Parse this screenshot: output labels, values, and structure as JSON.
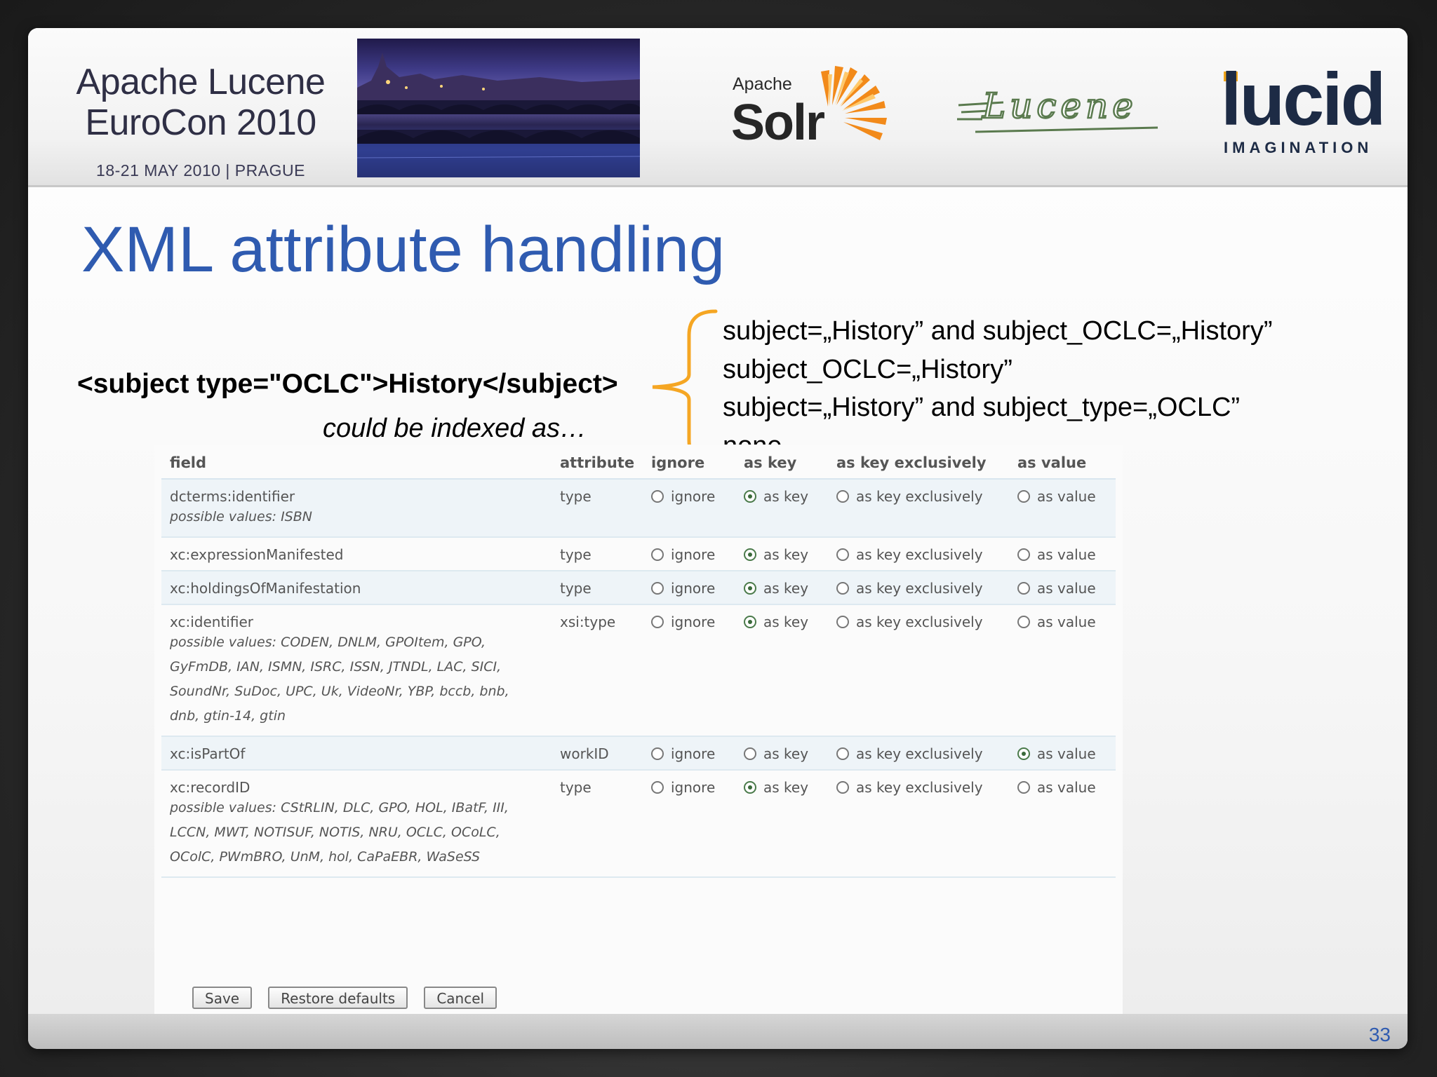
{
  "header": {
    "conference_line1": "Apache Lucene",
    "conference_line2": "EuroCon 2010",
    "conference_dates": "18-21 MAY 2010  |  PRAGUE",
    "solr_apache": "Apache",
    "solr_name": "Solr",
    "lucene_name": "Lucene",
    "lucid_name": "lucid",
    "lucid_sub": "IMAGINATION"
  },
  "title": "XML attribute handling",
  "example": {
    "xml": "<subject type=\"OCLC\">History</subject>",
    "caption": "could be indexed as…",
    "options": [
      "subject=„History” and subject_OCLC=„History”",
      "subject_OCLC=„History”",
      "subject=„History” and subject_type=„OCLC”",
      "none"
    ]
  },
  "table": {
    "headers": [
      "field",
      "attribute",
      "ignore",
      "as key",
      "as key exclusively",
      "as value"
    ],
    "option_labels": [
      "ignore",
      "as key",
      "as key exclusively",
      "as value"
    ],
    "rows": [
      {
        "field": "dcterms:identifier",
        "possible": "possible values: ISBN",
        "attribute": "type",
        "selected": "as key"
      },
      {
        "field": "xc:expressionManifested",
        "possible": "",
        "attribute": "type",
        "selected": "as key"
      },
      {
        "field": "xc:holdingsOfManifestation",
        "possible": "",
        "attribute": "type",
        "selected": "as key"
      },
      {
        "field": "xc:identifier",
        "possible": "possible values: CODEN, DNLM, GPOItem, GPO, GyFmDB, IAN, ISMN, ISRC, ISSN, JTNDL, LAC, SICI, SoundNr, SuDoc, UPC, Uk, VideoNr, YBP, bccb, bnb, dnb, gtin-14, gtin",
        "attribute": "xsi:type",
        "selected": "as key"
      },
      {
        "field": "xc:isPartOf",
        "possible": "",
        "attribute": "workID",
        "selected": "as value"
      },
      {
        "field": "xc:recordID",
        "possible": "possible values: CStRLIN, DLC, GPO, HOL, IBatF, III, LCCN, MWT, NOTISUF, NOTIS, NRU, OCLC, OCoLC, OColC, PWmBRO, UnM, hol, CaPaEBR, WaSeSS",
        "attribute": "type",
        "selected": "as key"
      }
    ]
  },
  "buttons": {
    "save": "Save",
    "restore": "Restore defaults",
    "cancel": "Cancel"
  },
  "page_number": "33",
  "colors": {
    "title_blue": "#2f5bb0",
    "brace_orange": "#f5a623",
    "row_alt": "#eef4f8"
  }
}
